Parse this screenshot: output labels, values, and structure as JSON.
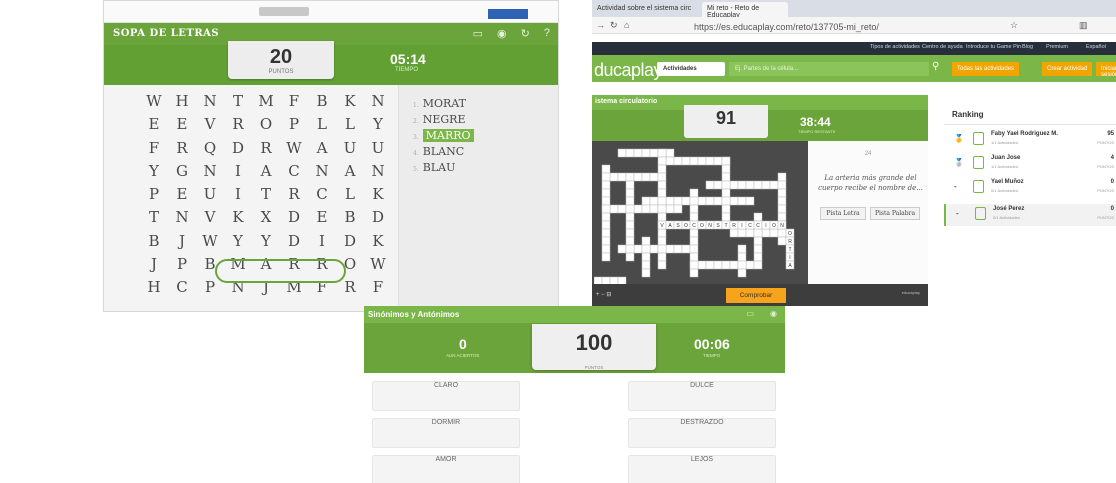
{
  "sopa": {
    "title": "SOPA DE LETRAS",
    "icons": [
      "fullscreen-icon",
      "volume-icon",
      "restart-icon",
      "help-icon"
    ],
    "icon_glyphs": [
      "▭",
      "◉",
      "↻",
      "?"
    ],
    "score": "20",
    "score_label": "PUNTOS",
    "time": "05:14",
    "time_label": "TIEMPO",
    "grid": [
      [
        "W",
        "H",
        "N",
        "T",
        "M",
        "F",
        "B",
        "K",
        "N"
      ],
      [
        "E",
        "E",
        "V",
        "R",
        "O",
        "P",
        "L",
        "L",
        "Y"
      ],
      [
        "F",
        "R",
        "Q",
        "D",
        "R",
        "W",
        "A",
        "U",
        "U"
      ],
      [
        "Y",
        "G",
        "N",
        "I",
        "A",
        "C",
        "N",
        "A",
        "N"
      ],
      [
        "P",
        "E",
        "U",
        "I",
        "T",
        "R",
        "C",
        "L",
        "K"
      ],
      [
        "T",
        "N",
        "V",
        "K",
        "X",
        "D",
        "E",
        "B",
        "D"
      ],
      [
        "B",
        "J",
        "W",
        "Y",
        "Y",
        "D",
        "I",
        "D",
        "K"
      ],
      [
        "J",
        "P",
        "B",
        "M",
        "A",
        "R",
        "R",
        "O",
        "W"
      ],
      [
        "H",
        "C",
        "P",
        "N",
        "J",
        "M",
        "F",
        "R",
        "F"
      ]
    ],
    "words": [
      {
        "n": "1.",
        "t": "MORAT"
      },
      {
        "n": "2.",
        "t": "NEGRE"
      },
      {
        "n": "3.",
        "t": "MARRO"
      },
      {
        "n": "4.",
        "t": "BLANC"
      },
      {
        "n": "5.",
        "t": "BLAU"
      }
    ],
    "selected_word": "MARRO",
    "accent": "#6ba43a"
  },
  "crucigrama": {
    "browser": {
      "tab1": "Actividad sobre el sistema circ",
      "tab2": "Mi reto - Reto de Educaplay",
      "url": "https://es.educaplay.com/reto/137705-mi_reto/"
    },
    "topnav": [
      "Tipos de actividades",
      "Centro de ayuda",
      "Introduce tu Game Pin",
      "Blog",
      "Premium",
      "Español"
    ],
    "logo": "ducaplay",
    "activities_button": "Actividades",
    "search_placeholder": "Ej. Partes de la célula...",
    "filter_button": "Todas las actividades",
    "create_button": "Crear actividad",
    "login_button": "Iniciar sesión",
    "title": "istema circulatorio",
    "score": "91",
    "score_label": "PUNTOS",
    "time": "38:44",
    "time_label": "TIEMPO RESTANTE",
    "clue_number": "24",
    "clue": "La arteria más grande del cuerpo recibe el nombre de...",
    "btn_letter": "Pista Letra",
    "btn_word": "Pista Palabra",
    "check_button": "Comprobar",
    "footer_brand": "educaplay",
    "entry_row": [
      "V",
      "A",
      "S",
      "O",
      "C",
      "O",
      "N",
      "S",
      "T",
      "R",
      "I",
      "C",
      "C",
      "I",
      "O",
      "N"
    ],
    "entry_col": [
      "O",
      "R",
      "T",
      "I",
      "A"
    ],
    "ranking_title": "Ranking",
    "ranking": [
      {
        "medal": "🥇",
        "name": "Faby Yael Rodriguez M.",
        "sub": "1/1 Actividades",
        "pts": "95",
        "pl": "PUNTOS"
      },
      {
        "medal": "🥈",
        "name": "Juan Jose",
        "sub": "1/1 Actividades",
        "pts": "4",
        "pl": "PUNTOS"
      },
      {
        "medal": "-",
        "name": "Yael Muñoz",
        "sub": "0/1 Actividades",
        "pts": "0",
        "pl": "PUNTOS"
      },
      {
        "medal": "-",
        "name": "José Perez",
        "sub": "0/1 Actividades",
        "pts": "0",
        "pl": "PUNTOS"
      }
    ],
    "accent": "#7ab648"
  },
  "sinonimos": {
    "title": "Sinónimos y Antónimos",
    "left_value": "0",
    "left_label": "AUN ACIERTOS",
    "score": "100",
    "score_label": "PUNTOS",
    "time": "00:06",
    "time_label": "TIEMPO",
    "cards_left": [
      "CLARO",
      "DORMIR",
      "AMOR"
    ],
    "cards_right": [
      "DULCE",
      "DESTRAZDO",
      "LEJOS"
    ],
    "accent": "#6ba43a"
  }
}
